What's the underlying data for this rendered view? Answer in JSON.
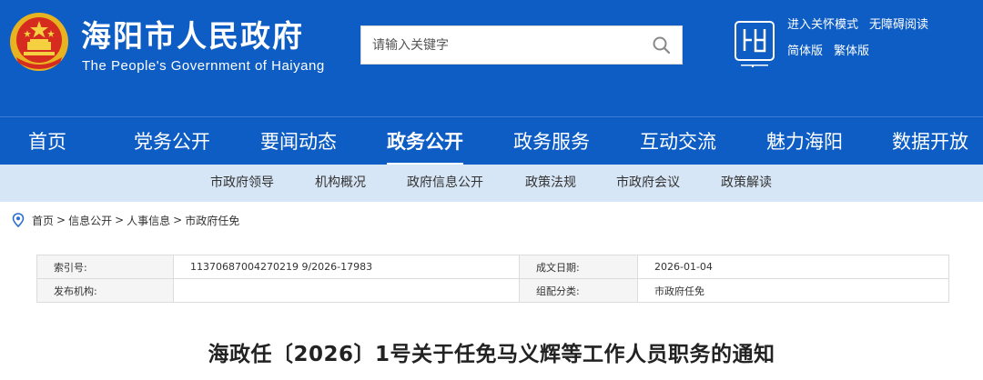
{
  "header": {
    "title": "海阳市人民政府",
    "subtitle": "The People's Government of Haiyang",
    "search_placeholder": "请输入关键字",
    "links_row1": [
      "进入关怀模式",
      "无障碍阅读"
    ],
    "links_row2": [
      "简体版",
      "繁体版"
    ],
    "colors": {
      "header_bg": "#0d5dc4",
      "subnav_bg": "#d7e6f6"
    }
  },
  "main_nav": [
    "首页",
    "党务公开",
    "要闻动态",
    "政务公开",
    "政务服务",
    "互动交流",
    "魅力海阳",
    "数据开放"
  ],
  "main_nav_active": "政务公开",
  "sub_nav": [
    "市政府领导",
    "机构概况",
    "政府信息公开",
    "政策法规",
    "市政府会议",
    "政策解读"
  ],
  "breadcrumb": [
    "首页",
    "信息公开",
    "人事信息",
    "市政府任免"
  ],
  "meta": {
    "index_label": "索引号:",
    "index_value": "11370687004270219 9/2026-17983",
    "date_label": "成文日期:",
    "date_value": "2026-01-04",
    "publisher_label": "发布机构:",
    "publisher_value": "",
    "category_label": "组配分类:",
    "category_value": "市政府任免"
  },
  "article": {
    "title": "海政任〔2026〕1号关于任免马义辉等工作人员职务的通知"
  }
}
